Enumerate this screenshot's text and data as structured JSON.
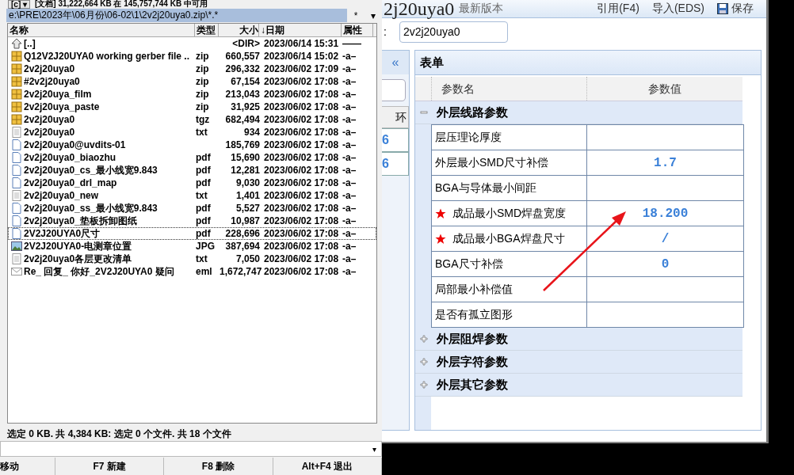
{
  "file_panel": {
    "drive": "[c]",
    "drive_caret": "▾",
    "free_space": "[文档] 31,222,664 KB 在 145,757,744 KB 中可用",
    "path": "e:\\PRE\\2023年\\06月份\\06-02\\1\\2v2j20uya0.zip\\*.*",
    "path_buttons": [
      "*",
      "▾"
    ],
    "columns": [
      "名称",
      "类型",
      "大小",
      "↓日期",
      "属性"
    ],
    "rows": [
      {
        "kind": "up",
        "name": "[..]",
        "type": "",
        "size": "<DIR>",
        "date": "2023/06/14 15:31",
        "attr": "——",
        "focused": false
      },
      {
        "kind": "archive",
        "name": "Q12V2J20UYA0 working gerber file ..",
        "type": "zip",
        "size": "660,557",
        "date": "2023/06/14 15:02",
        "attr": "-a–",
        "focused": false
      },
      {
        "kind": "archive",
        "name": "2v2j20uya0",
        "type": "zip",
        "size": "296,332",
        "date": "2023/06/02 17:09",
        "attr": "-a–",
        "focused": false
      },
      {
        "kind": "archive",
        "name": "#2v2j20uya0",
        "type": "zip",
        "size": "67,154",
        "date": "2023/06/02 17:08",
        "attr": "-a–",
        "focused": false
      },
      {
        "kind": "archive",
        "name": "2v2j20uya_film",
        "type": "zip",
        "size": "213,043",
        "date": "2023/06/02 17:08",
        "attr": "-a–",
        "focused": false
      },
      {
        "kind": "archive",
        "name": "2v2j20uya_paste",
        "type": "zip",
        "size": "31,925",
        "date": "2023/06/02 17:08",
        "attr": "-a–",
        "focused": false
      },
      {
        "kind": "archive",
        "name": "2v2j20uya0",
        "type": "tgz",
        "size": "682,494",
        "date": "2023/06/02 17:08",
        "attr": "-a–",
        "focused": false
      },
      {
        "kind": "text",
        "name": "2v2j20uya0",
        "type": "txt",
        "size": "934",
        "date": "2023/06/02 17:08",
        "attr": "-a–",
        "focused": false
      },
      {
        "kind": "document",
        "name": "2v2j20uya0@uvdits-01",
        "type": "",
        "size": "185,769",
        "date": "2023/06/02 17:08",
        "attr": "-a–",
        "focused": false
      },
      {
        "kind": "document",
        "name": "2v2j20uya0_biaozhu",
        "type": "pdf",
        "size": "15,690",
        "date": "2023/06/02 17:08",
        "attr": "-a–",
        "focused": false
      },
      {
        "kind": "document",
        "name": "2v2j20uya0_cs_最小线宽9.843",
        "type": "pdf",
        "size": "12,281",
        "date": "2023/06/02 17:08",
        "attr": "-a–",
        "focused": false
      },
      {
        "kind": "document",
        "name": "2v2j20uya0_drl_map",
        "type": "pdf",
        "size": "9,030",
        "date": "2023/06/02 17:08",
        "attr": "-a–",
        "focused": false
      },
      {
        "kind": "text",
        "name": "2v2j20uya0_new",
        "type": "txt",
        "size": "1,401",
        "date": "2023/06/02 17:08",
        "attr": "-a–",
        "focused": false
      },
      {
        "kind": "document",
        "name": "2v2j20uya0_ss_最小线宽9.843",
        "type": "pdf",
        "size": "5,527",
        "date": "2023/06/02 17:08",
        "attr": "-a–",
        "focused": false
      },
      {
        "kind": "document",
        "name": "2v2j20uya0_垫板拆卸图纸",
        "type": "pdf",
        "size": "10,987",
        "date": "2023/06/02 17:08",
        "attr": "-a–",
        "focused": false
      },
      {
        "kind": "document",
        "name": "2V2J20UYA0尺寸",
        "type": "pdf",
        "size": "228,696",
        "date": "2023/06/02 17:08",
        "attr": "-a–",
        "focused": true
      },
      {
        "kind": "image",
        "name": "2V2J20UYA0-电测章位置",
        "type": "JPG",
        "size": "387,694",
        "date": "2023/06/02 17:08",
        "attr": "-a–",
        "focused": false
      },
      {
        "kind": "text",
        "name": "2v2j20uya0各层更改清单",
        "type": "txt",
        "size": "7,050",
        "date": "2023/06/02 17:08",
        "attr": "-a–",
        "focused": false
      },
      {
        "kind": "mail",
        "name": "Re_ 回复_ 你好_2V2J20UYA0 疑问",
        "type": "eml",
        "size": "1,672,747",
        "date": "2023/06/02 17:08",
        "attr": "-a–",
        "focused": false
      }
    ],
    "status": "选定 0 KB. 共 4,384 KB: 选定 0 个文件. 共 18 个文件",
    "command_caret": "▾",
    "function_keys": [
      "移动",
      "F7 新建",
      "F8 删除",
      "Alt+F4 退出"
    ]
  },
  "form_window": {
    "title": "2j20uya0",
    "subtitle": "最新版本",
    "toolbar": [
      {
        "kind": "text",
        "label": "引用(F4)"
      },
      {
        "kind": "text",
        "label": "导入(EDS)"
      },
      {
        "kind": "save",
        "label": "保存"
      }
    ],
    "field_label": ":",
    "field_value": "2v2j20uya0",
    "side_panel": {
      "collapse": "«",
      "tab": "环",
      "values": [
        "6",
        "6"
      ]
    },
    "form": {
      "title": "表单",
      "columns": [
        "参数名",
        "参数值"
      ],
      "groups": [
        {
          "name": "外层线路参数",
          "expanded": true,
          "rows": [
            {
              "name": "层压理论厚度",
              "value": "",
              "required": false
            },
            {
              "name": "外层最小SMD尺寸补偿",
              "value": "1.7",
              "required": false
            },
            {
              "name": "BGA与导体最小间距",
              "value": "",
              "required": false
            },
            {
              "name": "成品最小SMD焊盘宽度",
              "value": "18.200",
              "required": true
            },
            {
              "name": "成品最小BGA焊盘尺寸",
              "value": "/",
              "required": true
            },
            {
              "name": "BGA尺寸补偿",
              "value": "0",
              "required": false
            },
            {
              "name": "局部最小补偿值",
              "value": "",
              "required": false
            },
            {
              "name": "是否有孤立图形",
              "value": "",
              "required": false
            }
          ]
        },
        {
          "name": "外层阻焊参数",
          "expanded": false
        },
        {
          "name": "外层字符参数",
          "expanded": false
        },
        {
          "name": "外层其它参数",
          "expanded": false
        }
      ]
    },
    "annotations": [
      {
        "kind": "arrow"
      }
    ]
  }
}
